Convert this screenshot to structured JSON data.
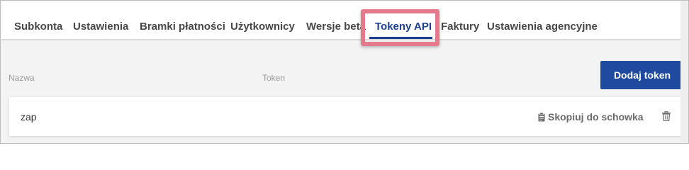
{
  "tabs": [
    {
      "label": "Subkonta"
    },
    {
      "label": "Ustawienia"
    },
    {
      "label": "Bramki płatności"
    },
    {
      "label": "Użytkownicy"
    },
    {
      "label": "Wersje beta"
    },
    {
      "label": "Tokeny API"
    },
    {
      "label": "Faktury"
    },
    {
      "label": "Ustawienia agencyjne"
    }
  ],
  "active_tab": "Tokeny API",
  "columns": {
    "name": "Nazwa",
    "token": "Token"
  },
  "add_button_label": "Dodaj token",
  "tokens": [
    {
      "name": "zap",
      "copy_label": "Skopiuj do schowka",
      "copy_icon": "clipboard-icon",
      "delete_icon": "trash-icon"
    }
  ],
  "colors": {
    "accent": "#1f4aa0",
    "highlight": "#e47a8c"
  }
}
